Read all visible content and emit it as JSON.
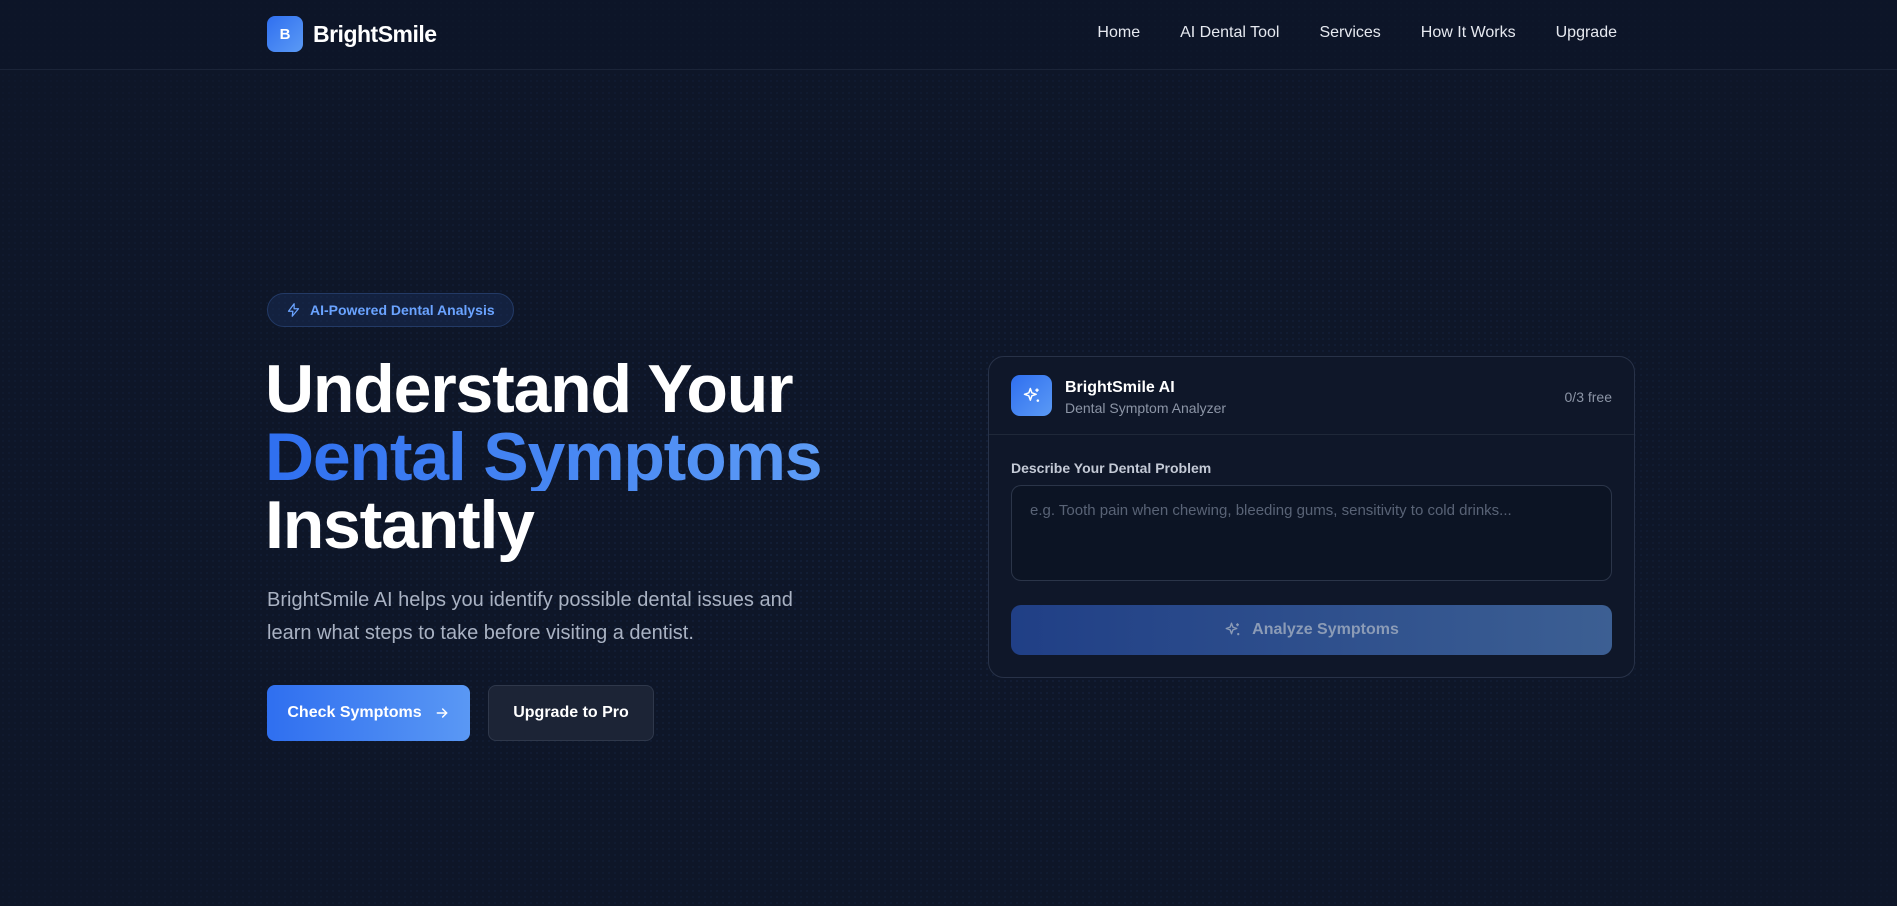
{
  "nav": {
    "brand_initial": "B",
    "brand_name": "BrightSmile",
    "links": [
      "Home",
      "AI Dental Tool",
      "Services",
      "How It Works",
      "Upgrade"
    ]
  },
  "hero": {
    "badge": "AI-Powered Dental Analysis",
    "headline_line1": "Understand Your",
    "headline_line2": "Dental Symptoms",
    "headline_line3": "Instantly",
    "subtitle": "BrightSmile AI helps you identify possible dental issues and learn what steps to take before visiting a dentist.",
    "cta_primary": "Check Symptoms",
    "cta_secondary": "Upgrade to Pro"
  },
  "card": {
    "title": "BrightSmile AI",
    "subtitle": "Dental Symptom Analyzer",
    "usage": "0/3 free",
    "field_label": "Describe Your Dental Problem",
    "placeholder": "e.g. Tooth pain when chewing, bleeding gums, sensitivity to cold drinks...",
    "analyze_label": "Analyze Symptoms"
  },
  "colors": {
    "background": "#0e1628",
    "accent": "#2f6ff0",
    "accent_light": "#5b9af5"
  },
  "icons": {
    "badge": "lightning-icon",
    "cta_primary": "arrow-right-icon",
    "card": "sparkles-icon",
    "analyze": "sparkles-icon"
  }
}
